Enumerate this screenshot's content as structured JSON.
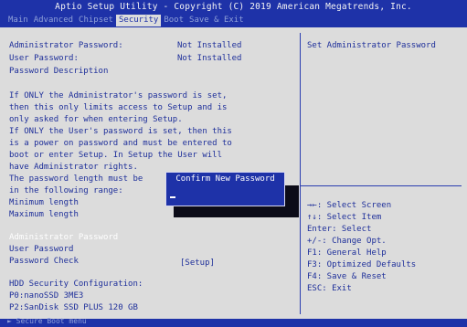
{
  "window": {
    "title": "Aptio Setup Utility - Copyright (C) 2019 American Megatrends, Inc."
  },
  "tabs": [
    "Main",
    "Advanced",
    "Chipset",
    "Security",
    "Boot",
    "Save & Exit"
  ],
  "active_tab": "Security",
  "left_panel": {
    "admin_password": {
      "label": "Administrator Password:",
      "value": "Not Installed"
    },
    "user_password": {
      "label": "User Password:",
      "value": "Not Installed"
    },
    "password_description": "Password Description",
    "description_lines": [
      "If ONLY the Administrator's password is set,",
      "then this only limits access to Setup and is",
      "only asked for when entering Setup.",
      "If ONLY the User's password is set, then this",
      "is a power on password and must be entered to",
      "boot or enter Setup. In Setup the User will",
      "have Administrator rights.",
      "The password length must be",
      "in the following range:"
    ],
    "min_length_label": "Minimum length",
    "max_length_label": "Maximum length",
    "menu_items": {
      "admin_password": "Administrator Password",
      "user_password": "User Password",
      "password_check": {
        "label": "Password Check",
        "value": "[Setup]"
      }
    },
    "hdd_security": {
      "heading": "HDD Security Configuration:",
      "drives": [
        "P0:nanoSSD 3ME3",
        "P2:SanDisk SSD PLUS 120 GB"
      ]
    }
  },
  "right_panel": {
    "help_text": "Set Administrator Password",
    "key_help": [
      "→←: Select Screen",
      "↑↓: Select Item",
      "Enter: Select",
      "+/-: Change Opt.",
      "F1: General Help",
      "F3: Optimized Defaults",
      "F4: Save & Reset",
      "ESC: Exit"
    ]
  },
  "dialog": {
    "title": "Confirm New Password",
    "input_value": ""
  },
  "footer": {
    "text": "► Secure Boot menu"
  },
  "colors": {
    "bios_blue": "#1e32a8",
    "background": "#dcdcdc",
    "text_blue": "#1e2f9a",
    "highlight": "#ffffff"
  }
}
